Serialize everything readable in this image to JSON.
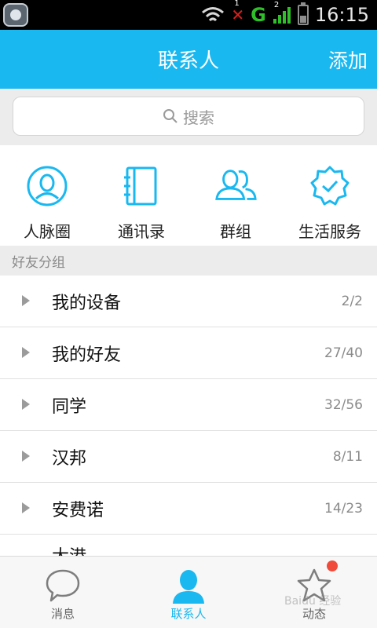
{
  "statusbar": {
    "signal_sim_index": "1",
    "network_type": "G",
    "signal_sim2_index": "2",
    "time": "16:15"
  },
  "header": {
    "title": "联系人",
    "add_label": "添加",
    "color": "#1ab8f0"
  },
  "search": {
    "placeholder": "搜索"
  },
  "features": [
    {
      "label": "人脉圈",
      "icon": "person-circle-icon"
    },
    {
      "label": "通讯录",
      "icon": "address-book-icon"
    },
    {
      "label": "群组",
      "icon": "group-icon"
    },
    {
      "label": "生活服务",
      "icon": "badge-check-icon"
    }
  ],
  "group_header": "好友分组",
  "groups": [
    {
      "name": "我的设备",
      "count": "2/2"
    },
    {
      "name": "我的好友",
      "count": "27/40"
    },
    {
      "name": "同学",
      "count": "32/56"
    },
    {
      "name": "汉邦",
      "count": "8/11"
    },
    {
      "name": "安费诺",
      "count": "14/23"
    }
  ],
  "partial_group": {
    "name": "大港"
  },
  "bottom_nav": [
    {
      "label": "消息",
      "icon": "chat-bubble-icon",
      "active": false
    },
    {
      "label": "联系人",
      "icon": "contact-person-icon",
      "active": true
    },
    {
      "label": "动态",
      "icon": "star-icon",
      "active": false
    }
  ],
  "watermark": "Baidu 经验"
}
